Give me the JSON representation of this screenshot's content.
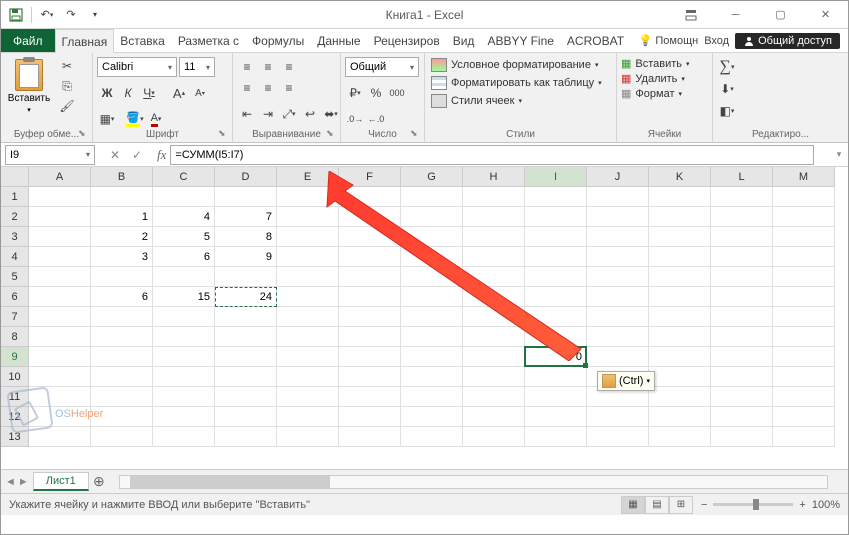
{
  "title": "Книга1 - Excel",
  "tabs": {
    "file": "Файл",
    "home": "Главная",
    "insert": "Вставка",
    "layout": "Разметка с",
    "formulas": "Формулы",
    "data": "Данные",
    "review": "Рецензиров",
    "view": "Вид",
    "abbyy": "ABBYY Fine",
    "acrobat": "ACROBAT"
  },
  "tabRight": {
    "help": "Помощн",
    "login": "Вход",
    "share": "Общий доступ"
  },
  "ribbon": {
    "clipboard": {
      "paste": "Вставить",
      "label": "Буфер обме..."
    },
    "font": {
      "name": "Calibri",
      "size": "11",
      "label": "Шрифт"
    },
    "align": {
      "label": "Выравнивание"
    },
    "number": {
      "format": "Общий",
      "label": "Число"
    },
    "styles": {
      "cond": "Условное форматирование",
      "table": "Форматировать как таблицу",
      "cell": "Стили ячеек",
      "label": "Стили"
    },
    "cells": {
      "insert": "Вставить",
      "delete": "Удалить",
      "format": "Формат",
      "label": "Ячейки"
    },
    "edit": {
      "label": "Редактиро..."
    }
  },
  "namebox": "I9",
  "formula": "=СУММ(I5:I7)",
  "columns": [
    "A",
    "B",
    "C",
    "D",
    "E",
    "F",
    "G",
    "H",
    "I",
    "J",
    "K",
    "L",
    "M"
  ],
  "rows": [
    "1",
    "2",
    "3",
    "4",
    "5",
    "6",
    "7",
    "8",
    "9",
    "10",
    "11",
    "12",
    "13"
  ],
  "gridData": {
    "B2": "1",
    "C2": "4",
    "D2": "7",
    "B3": "2",
    "C3": "5",
    "D3": "8",
    "B4": "3",
    "C4": "6",
    "D4": "9",
    "B6": "6",
    "C6": "15",
    "D6": "24",
    "I9": "0"
  },
  "pasteOpt": "(Ctrl)",
  "sheet": "Лист1",
  "status": "Укажите ячейку и нажмите ВВОД или выберите \"Вставить\"",
  "zoom": "100%",
  "watermark": {
    "a": "OS",
    "b": "Helper"
  },
  "chart_data": null
}
